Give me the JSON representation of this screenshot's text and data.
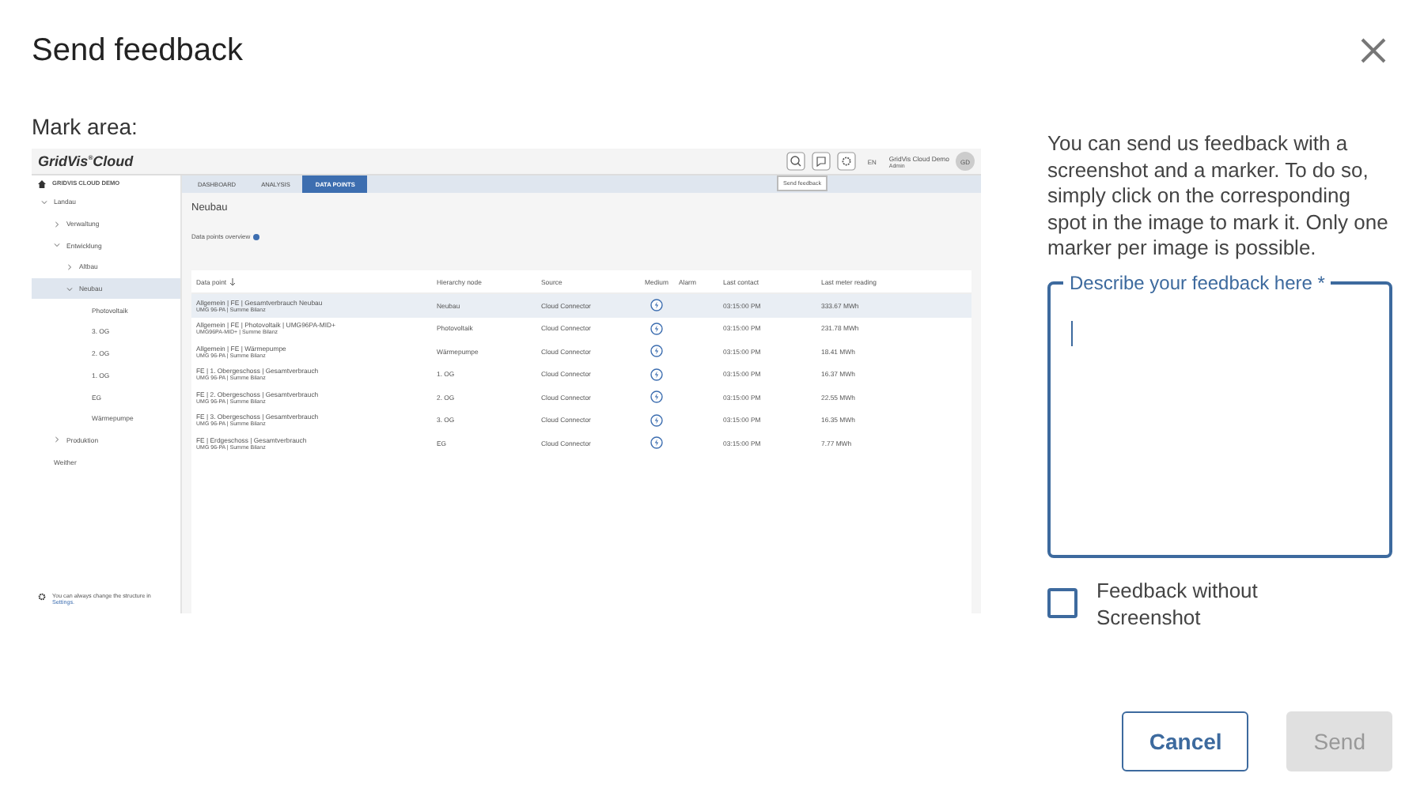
{
  "dialog": {
    "title": "Send feedback"
  },
  "mark_area_label": "Mark area:",
  "screenshot": {
    "logo": "GridVis$^{®}$Cloud",
    "header": {
      "language": "EN",
      "user_name": "GridVis Cloud Demo",
      "user_role": "Admin",
      "avatar": "GD",
      "tooltip": "Send feedback"
    },
    "sidebar": {
      "root": "GRIDVIS CLOUD DEMO",
      "items": [
        {
          "label": "Landau",
          "expanded": true,
          "selected": false,
          "children": [
            {
              "label": "Verwaltung",
              "expanded": false,
              "selected": false
            },
            {
              "label": "Entwicklung",
              "expanded": true,
              "selected": false,
              "children": [
                {
                  "label": "Altbau",
                  "expanded": false,
                  "selected": false
                },
                {
                  "label": "Neubau",
                  "expanded": true,
                  "selected": true,
                  "children": [
                    {
                      "label": "Photovoltaik",
                      "selected": false
                    },
                    {
                      "label": "3. OG",
                      "selected": false
                    },
                    {
                      "label": "2. OG",
                      "selected": false
                    },
                    {
                      "label": "1. OG",
                      "selected": false
                    },
                    {
                      "label": "EG",
                      "selected": false
                    },
                    {
                      "label": "Wärmepumpe",
                      "selected": false
                    }
                  ]
                }
              ]
            },
            {
              "label": "Produktion",
              "expanded": false,
              "selected": false
            }
          ]
        },
        {
          "label": "Weither",
          "selected": false
        }
      ],
      "footer": "You can always change the structure in",
      "footer_link": "Settings."
    },
    "tabs": [
      {
        "label": "DASHBOARD",
        "selected": false
      },
      {
        "label": "ANALYSIS",
        "selected": false
      },
      {
        "label": "DATA POINTS",
        "selected": true
      }
    ],
    "page_title": "Neubau",
    "overview_label": "Data points overview",
    "table": {
      "columns": [
        "Data point",
        "Hierarchy node",
        "Source",
        "Medium",
        "Alarm",
        "Last contact",
        "Last meter reading"
      ],
      "rows": [
        {
          "name": "Allgemein | FE | Gesamtverbrauch Neubau",
          "device": "UMG 96-PA | Summe Bilanz",
          "node": "Neubau",
          "source": "Cloud Connector",
          "last_contact": "03:15:00 PM",
          "reading": "333.67 MWh",
          "selected": true
        },
        {
          "name": "Allgemein | FE | Photovoltaik | UMG96PA-MID+",
          "device": "UMG96PA-MID+ | Summe Bilanz",
          "node": "Photovoltaik",
          "source": "Cloud Connector",
          "last_contact": "03:15:00 PM",
          "reading": "231.78 MWh",
          "selected": false
        },
        {
          "name": "Allgemein | FE | Wärmepumpe",
          "device": "UMG 96-PA | Summe Bilanz",
          "node": "Wärmepumpe",
          "source": "Cloud Connector",
          "last_contact": "03:15:00 PM",
          "reading": "18.41 MWh",
          "selected": false
        },
        {
          "name": "FE | 1. Obergeschoss | Gesamtverbrauch",
          "device": "UMG 96-PA | Summe Bilanz",
          "node": "1. OG",
          "source": "Cloud Connector",
          "last_contact": "03:15:00 PM",
          "reading": "16.37 MWh",
          "selected": false
        },
        {
          "name": "FE | 2. Obergeschoss | Gesamtverbrauch",
          "device": "UMG 96-PA | Summe Bilanz",
          "node": "2. OG",
          "source": "Cloud Connector",
          "last_contact": "03:15:00 PM",
          "reading": "22.55 MWh",
          "selected": false
        },
        {
          "name": "FE | 3. Obergeschoss | Gesamtverbrauch",
          "device": "UMG 96-PA | Summe Bilanz",
          "node": "3. OG",
          "source": "Cloud Connector",
          "last_contact": "03:15:00 PM",
          "reading": "16.35 MWh",
          "selected": false
        },
        {
          "name": "FE | Erdgeschoss | Gesamtverbrauch",
          "device": "UMG 96-PA | Summe Bilanz",
          "node": "EG",
          "source": "Cloud Connector",
          "last_contact": "03:15:00 PM",
          "reading": "7.77 MWh",
          "selected": false
        }
      ]
    }
  },
  "info_text": "You can send us feedback with a screenshot and a marker. To do so, simply click on the corresponding spot in the image to mark it. Only one marker per image is possible.",
  "feedback_field": {
    "label": "Describe your feedback here *",
    "focused": true
  },
  "checkbox": {
    "label": "Feedback without Screenshot",
    "checked": false
  },
  "buttons": [
    {
      "label": "Cancel",
      "kind": "secondary",
      "disabled": false
    },
    {
      "label": "Send",
      "kind": "primary",
      "disabled": true
    }
  ]
}
